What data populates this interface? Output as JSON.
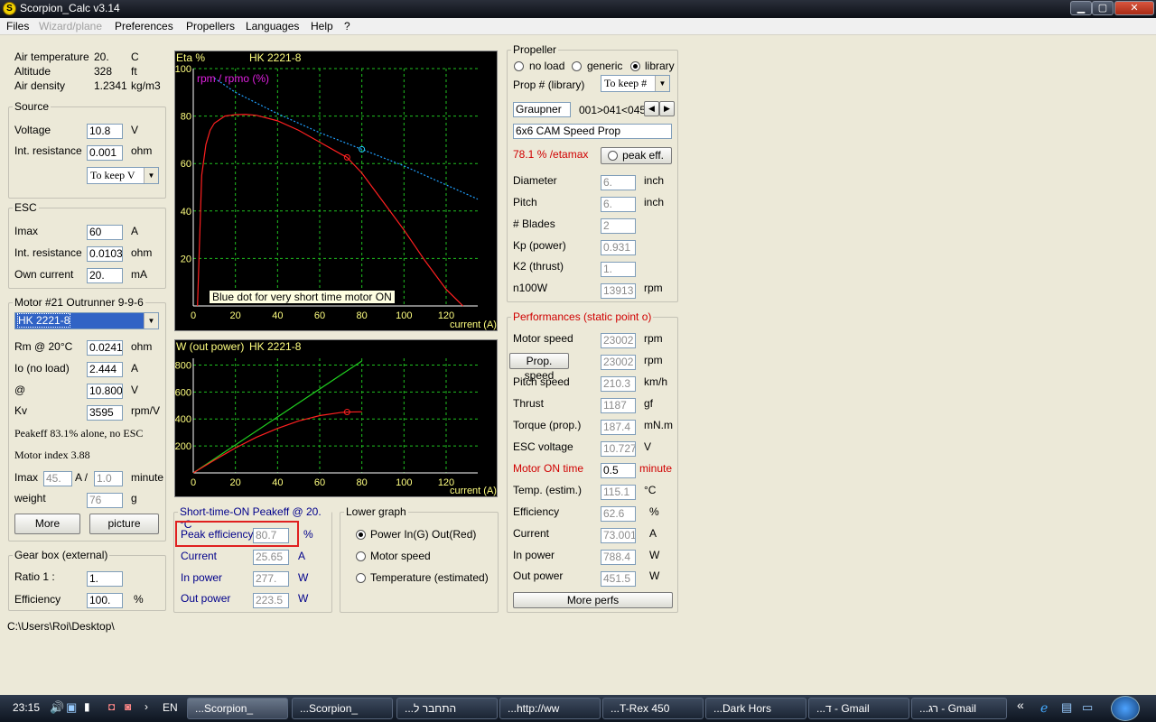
{
  "window": {
    "title": "Scorpion_Calc v3.14",
    "minimize": "▁",
    "maximize": "▢",
    "close": "✕",
    "app_icon": "S"
  },
  "menu": [
    "Files",
    "Wizard/plane",
    "Preferences",
    "Propellers",
    "Languages",
    "Help",
    "?"
  ],
  "air": {
    "temperature_label": "Air temperature",
    "temperature_value": "20.",
    "temperature_unit": "C",
    "altitude_label": "Altitude",
    "altitude_value": "328",
    "altitude_unit": "ft",
    "density_label": "Air density",
    "density_value": "1.2341",
    "density_unit": "kg/m3"
  },
  "source": {
    "legend": "Source",
    "voltage_label": "Voltage",
    "voltage_value": "10.8",
    "voltage_unit": "V",
    "resistance_label": "Int. resistance",
    "resistance_value": "0.001",
    "resistance_unit": "ohm",
    "mode": "To keep V"
  },
  "esc": {
    "legend": "ESC",
    "imax_label": "Imax",
    "imax_value": "60",
    "imax_unit": "A",
    "resistance_label": "Int. resistance",
    "resistance_value": "0.0103",
    "resistance_unit": "ohm",
    "own_label": "Own current",
    "own_value": "20.",
    "own_unit": "mA"
  },
  "motor": {
    "legend": "Motor #21   Outrunner 9-9-6",
    "selected": "HK 2221-8",
    "rm_label": "Rm @ 20°C",
    "rm_value": "0.0241",
    "rm_unit": "ohm",
    "io_label": "Io (no load)",
    "io_value": "2.444",
    "io_unit": "A",
    "at_label": "@",
    "at_value": "10.800",
    "at_unit": "V",
    "kv_label": "Kv",
    "kv_value": "3595",
    "kv_unit": "rpm/V",
    "peakeff": "Peakeff  83.1% alone, no ESC",
    "index": "Motor index   3.88",
    "imax_label": "Imax",
    "imax_value": "45.",
    "imax_sep": "A /",
    "imax_time": "1.0",
    "imax_time_unit": "minute",
    "weight_label": "weight",
    "weight_value": "76",
    "weight_unit": "g",
    "more_button": "More",
    "picture_button": "picture"
  },
  "gearbox": {
    "legend": "Gear box (external)",
    "ratio_label": "Ratio 1 :",
    "ratio_value": "1.",
    "eff_label": "Efficiency",
    "eff_value": "100.",
    "eff_unit": "%"
  },
  "path": "C:\\Users\\Roi\\Desktop\\",
  "upper_chart": {
    "ylabel": "Eta %",
    "motor": "HK 2221-8",
    "legend2": "rpm / rpmo (%)",
    "tooltip": "Blue dot for very short time motor ON",
    "xlabel": "current (A)",
    "yticks": [
      "100",
      "80",
      "60",
      "40",
      "20"
    ],
    "xticks": [
      "0",
      "20",
      "40",
      "60",
      "80",
      "100",
      "120"
    ]
  },
  "lower_chart": {
    "ylabel": "W (out power)",
    "motor": "HK 2221-8",
    "xlabel": "current (A)",
    "yticks": [
      "800",
      "600",
      "400",
      "200"
    ],
    "xticks": [
      "0",
      "20",
      "40",
      "60",
      "80",
      "100",
      "120"
    ]
  },
  "chart_data": [
    {
      "type": "line",
      "title": "HK 2221-8",
      "ylabel": "Eta %",
      "xlabel": "current (A)",
      "xlim": [
        0,
        135
      ],
      "ylim": [
        0,
        100
      ],
      "grid": true,
      "series": [
        {
          "name": "Eta %",
          "color": "#ff2020",
          "x": [
            2,
            4,
            6,
            8,
            10,
            15,
            20,
            25,
            30,
            40,
            50,
            60,
            70,
            73,
            80,
            90,
            100,
            110,
            120,
            128
          ],
          "y": [
            0,
            55,
            68,
            74,
            77,
            80,
            80.6,
            80.7,
            80.3,
            78,
            74,
            69,
            64,
            62.6,
            56,
            44,
            32,
            19,
            7,
            0
          ]
        },
        {
          "name": "rpm / rpmo (%)",
          "color": "#20a0ff",
          "x": [
            10,
            20,
            40,
            60,
            80,
            100,
            120,
            135
          ],
          "y": [
            96,
            90,
            81,
            73,
            66,
            59,
            51,
            45
          ]
        }
      ],
      "markers": [
        {
          "x": 73,
          "y": 62.6,
          "color": "#ff2020"
        },
        {
          "x": 80,
          "y": 66,
          "color": "#20d0ff"
        }
      ]
    },
    {
      "type": "line",
      "title": "HK 2221-8",
      "ylabel": "W (out power)",
      "xlabel": "current (A)",
      "xlim": [
        0,
        135
      ],
      "ylim": [
        0,
        850
      ],
      "grid": true,
      "series": [
        {
          "name": "Power In",
          "color": "#20d020",
          "x": [
            0,
            80
          ],
          "y": [
            0,
            830
          ]
        },
        {
          "name": "Out",
          "color": "#ff2020",
          "x": [
            0,
            10,
            20,
            30,
            40,
            50,
            60,
            70,
            73,
            80
          ],
          "y": [
            0,
            95,
            185,
            265,
            330,
            385,
            425,
            448,
            451.5,
            453
          ]
        }
      ],
      "markers": [
        {
          "x": 73,
          "y": 451.5,
          "color": "#ff2020"
        }
      ]
    }
  ],
  "shorttime": {
    "legend": "Short-time-ON Peakeff @ 20.°C",
    "peak_label": "Peak efficiency",
    "peak_value": "80.7",
    "peak_unit": "%",
    "current_label": "Current",
    "current_value": "25.65",
    "current_unit": "A",
    "inpower_label": "In power",
    "inpower_value": "277.",
    "inpower_unit": "W",
    "outpower_label": "Out power",
    "outpower_value": "223.5",
    "outpower_unit": "W"
  },
  "lowergraph": {
    "legend": "Lower graph",
    "opt1": "Power In(G)  Out(Red)",
    "opt2": "Motor speed",
    "opt3": "Temperature (estimated)"
  },
  "propeller": {
    "legend": "Propeller",
    "r_noload": "no load",
    "r_generic": "generic",
    "r_library": "library",
    "prop_label": "Prop # (library)",
    "prop_mode": "To keep #",
    "maker": "Graupner",
    "index": "001>041<045",
    "name": "6x6 CAM Speed Prop",
    "etamax": "78.1 % /etamax",
    "peak_button": "peak eff.",
    "diameter_label": "Diameter",
    "diameter_value": "6.",
    "diameter_unit": "inch",
    "pitch_label": "Pitch",
    "pitch_value": "6.",
    "pitch_unit": "inch",
    "blades_label": "# Blades",
    "blades_value": "2",
    "kp_label": "Kp (power)",
    "kp_value": "0.931",
    "k2_label": "K2 (thrust)",
    "k2_value": "1.",
    "n100_label": "n100W",
    "n100_value": "13913",
    "n100_unit": "rpm"
  },
  "perf": {
    "legend": "Performances (static point o)",
    "motor_speed_label": "Motor speed",
    "motor_speed_value": "23002",
    "motor_speed_unit": "rpm",
    "prop_speed_button": "Prop. speed",
    "prop_speed_value": "23002",
    "prop_speed_unit": "rpm",
    "pitch_speed_label": "Pitch speed",
    "pitch_speed_value": "210.3",
    "pitch_speed_unit": "km/h",
    "thrust_label": "Thrust",
    "thrust_value": "1187",
    "thrust_unit": "gf",
    "torque_label": "Torque (prop.)",
    "torque_value": "187.4",
    "torque_unit": "mN.m",
    "escv_label": "ESC voltage",
    "escv_value": "10.727",
    "escv_unit": "V",
    "ontime_label": "Motor ON time",
    "ontime_value": "0.5",
    "ontime_unit": "minute",
    "temp_label": "Temp. (estim.)",
    "temp_value": "115.1",
    "temp_unit": "°C",
    "eff_label": "Efficiency",
    "eff_value": "62.6",
    "eff_unit": "%",
    "current_label": "Current",
    "current_value": "73.001",
    "current_unit": "A",
    "inpower_label": "In power",
    "inpower_value": "788.4",
    "inpower_unit": "W",
    "outpower_label": "Out power",
    "outpower_value": "451.5",
    "outpower_unit": "W",
    "more_button": "More perfs"
  },
  "taskbar": {
    "time": "23:15",
    "lang": "EN",
    "tasks": [
      "...Scorpion_",
      "...Scorpion_",
      "...התחבר ל",
      "...http://ww",
      "...T-Rex 450",
      "...Dark Hors",
      "...ד - Gmail",
      "...רג - Gmail"
    ],
    "chevron": "«"
  }
}
